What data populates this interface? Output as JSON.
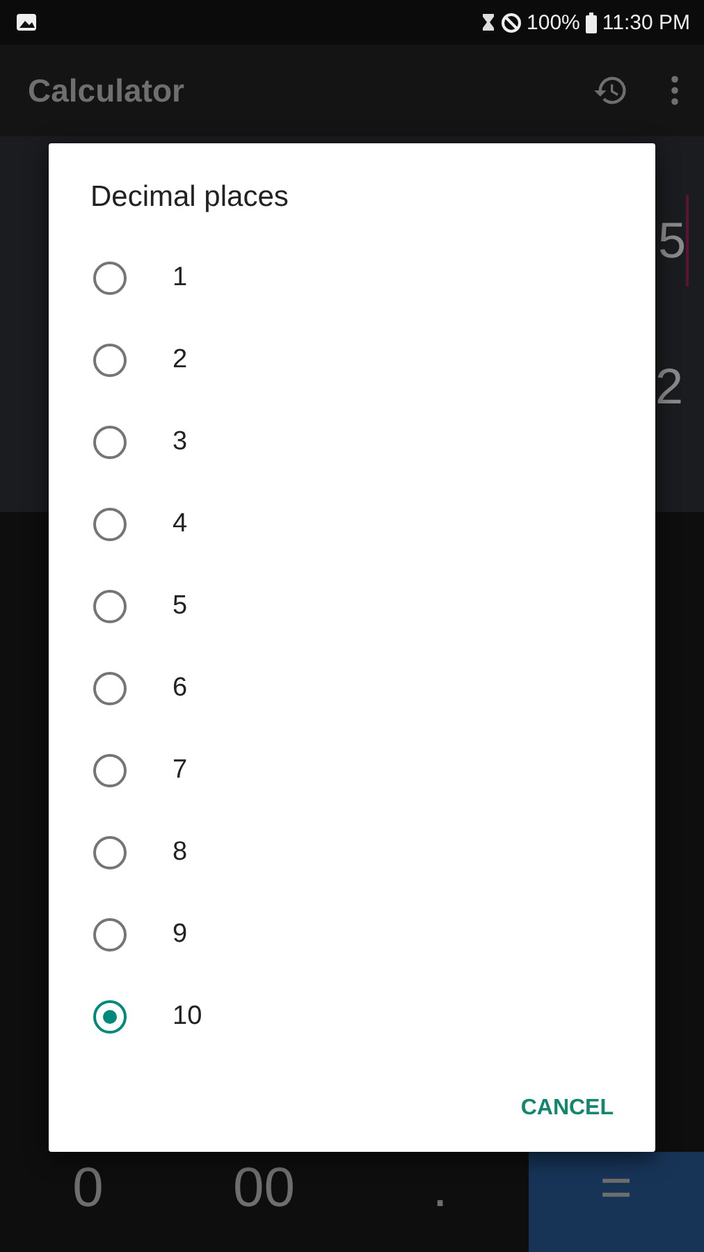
{
  "status_bar": {
    "battery": "100%",
    "time": "11:30 PM"
  },
  "app_bar": {
    "title": "Calculator"
  },
  "display": {
    "expression": "5",
    "result": "2"
  },
  "keypad": [
    {
      "label": "0",
      "kind": "digit"
    },
    {
      "label": "00",
      "kind": "digit"
    },
    {
      "label": ".",
      "kind": "digit"
    },
    {
      "label": "=",
      "kind": "equals"
    }
  ],
  "dialog": {
    "title": "Decimal places",
    "options": [
      {
        "label": "1",
        "selected": false
      },
      {
        "label": "2",
        "selected": false
      },
      {
        "label": "3",
        "selected": false
      },
      {
        "label": "4",
        "selected": false
      },
      {
        "label": "5",
        "selected": false
      },
      {
        "label": "6",
        "selected": false
      },
      {
        "label": "7",
        "selected": false
      },
      {
        "label": "8",
        "selected": false
      },
      {
        "label": "9",
        "selected": false
      },
      {
        "label": "10",
        "selected": true
      }
    ],
    "buttons": [
      "CANCEL"
    ]
  }
}
